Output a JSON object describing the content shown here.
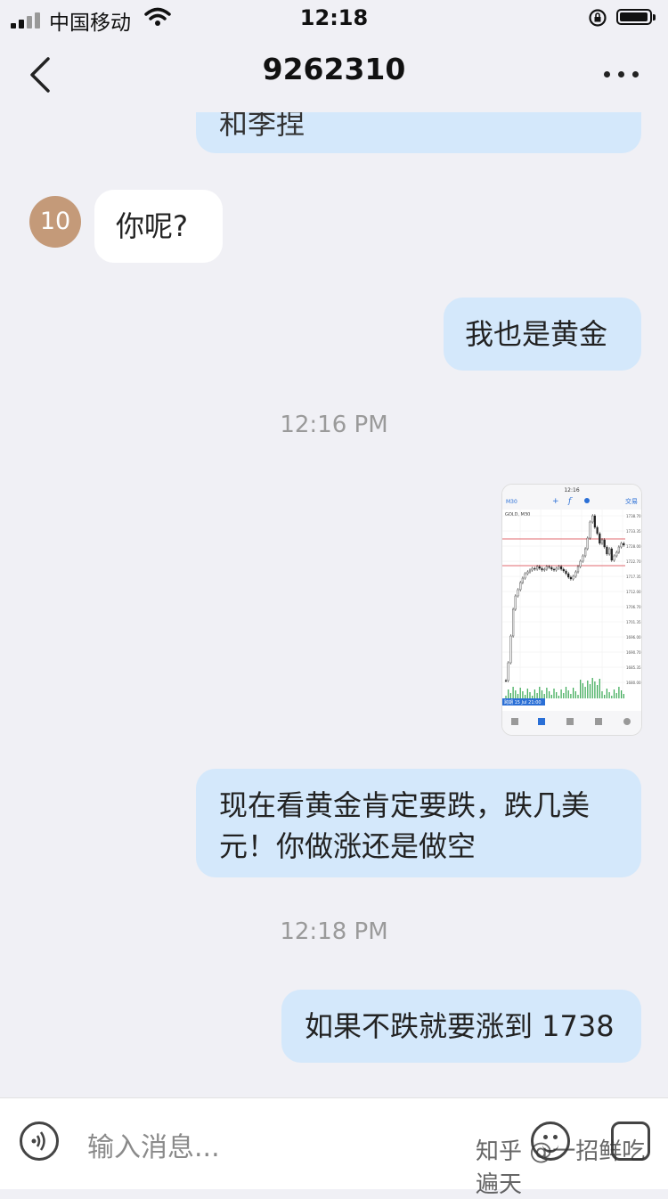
{
  "status_bar": {
    "carrier": "中国移动",
    "time": "12:18"
  },
  "nav": {
    "title": "9262310"
  },
  "messages": [
    {
      "type": "text",
      "from": "me",
      "text": "和李捏"
    },
    {
      "type": "text",
      "from": "them",
      "avatar": "10",
      "text": "你呢?"
    },
    {
      "type": "text",
      "from": "me",
      "text": "我也是黄金"
    },
    {
      "type": "timestamp",
      "text": "12:16 PM"
    },
    {
      "type": "image",
      "from": "me"
    },
    {
      "type": "text",
      "from": "me",
      "lines": [
        "现在看黄金肯定要跌，跌几美",
        "元！你做涨还是做空"
      ]
    },
    {
      "type": "timestamp",
      "text": "12:18 PM"
    },
    {
      "type": "text",
      "from": "me",
      "text": "如果不跌就要涨到 1738"
    }
  ],
  "chart_screenshot": {
    "symbol": "GOLD, M30",
    "header_time": "12:16",
    "trade_label": "交易",
    "bottom_label": "跨期 15 Jul 21:00",
    "price_ticks": [
      "1738.70",
      "1733.35",
      "1728.00",
      "1722.70",
      "1717.35",
      "1712.00",
      "1706.70",
      "1701.35",
      "1696.00",
      "1690.70",
      "1685.35",
      "1680.00"
    ]
  },
  "input": {
    "placeholder": "输入消息..."
  },
  "watermark": "知乎 @一招鲜吃遍天",
  "colors": {
    "my_bubble": "#d4e8fb",
    "their_bubble": "#ffffff",
    "background": "#f0f0f5",
    "avatar": "#c49a79"
  }
}
